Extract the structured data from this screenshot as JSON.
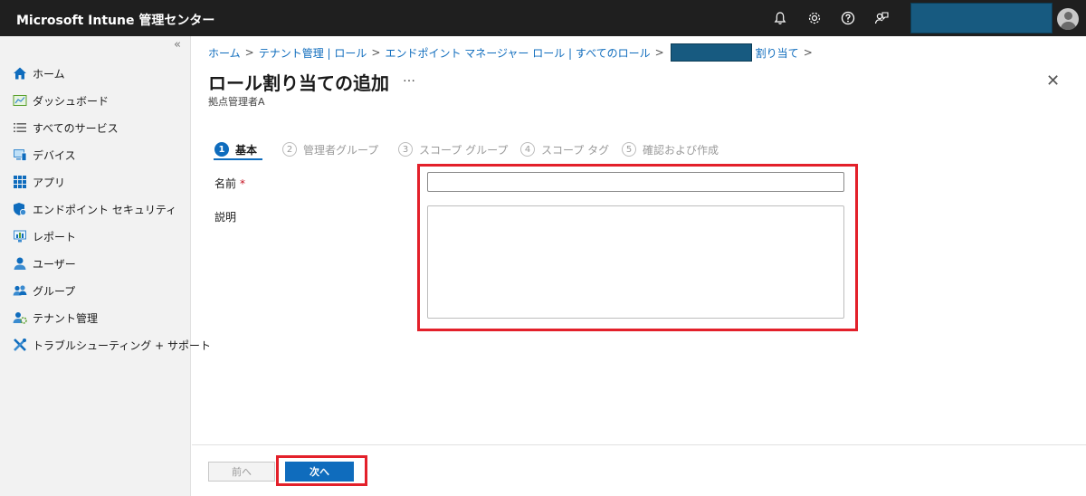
{
  "header": {
    "app_title": "Microsoft Intune 管理センター",
    "icons": [
      "bell-icon",
      "gear-icon",
      "help-icon",
      "feedback-icon"
    ]
  },
  "sidebar": {
    "collapse_glyph": "«",
    "items": [
      {
        "label": "ホーム",
        "icon": "home-icon"
      },
      {
        "label": "ダッシュボード",
        "icon": "dashboard-icon"
      },
      {
        "label": "すべてのサービス",
        "icon": "list-icon"
      },
      {
        "label": "デバイス",
        "icon": "device-icon"
      },
      {
        "label": "アプリ",
        "icon": "apps-grid-icon"
      },
      {
        "label": "エンドポイント セキュリティ",
        "icon": "shield-icon"
      },
      {
        "label": "レポート",
        "icon": "report-icon"
      },
      {
        "label": "ユーザー",
        "icon": "user-icon"
      },
      {
        "label": "グループ",
        "icon": "group-icon"
      },
      {
        "label": "テナント管理",
        "icon": "tenant-admin-icon"
      },
      {
        "label": "トラブルシューティング + サポート",
        "icon": "troubleshoot-icon"
      }
    ]
  },
  "breadcrumb": {
    "items": [
      "ホーム",
      "テナント管理 | ロール",
      "エンドポイント マネージャー ロール | すべてのロール",
      "割り当て"
    ],
    "separator": ">"
  },
  "page": {
    "title": "ロール割り当ての追加",
    "more": "…",
    "subtitle": "拠点管理者A",
    "close": "✕"
  },
  "wizard": {
    "steps": [
      {
        "num": "1",
        "label": "基本",
        "active": true
      },
      {
        "num": "2",
        "label": "管理者グループ",
        "active": false
      },
      {
        "num": "3",
        "label": "スコープ グループ",
        "active": false
      },
      {
        "num": "4",
        "label": "スコープ タグ",
        "active": false
      },
      {
        "num": "5",
        "label": "確認および作成",
        "active": false
      }
    ]
  },
  "form": {
    "name_label": "名前",
    "required_mark": "*",
    "name_value": "",
    "description_label": "説明",
    "description_value": ""
  },
  "footer": {
    "prev_label": "前へ",
    "next_label": "次へ"
  },
  "colors": {
    "accent": "#0f6cbd",
    "highlight": "#e3202a",
    "topbar": "#1f1f1f",
    "redacted": "#175a80"
  }
}
